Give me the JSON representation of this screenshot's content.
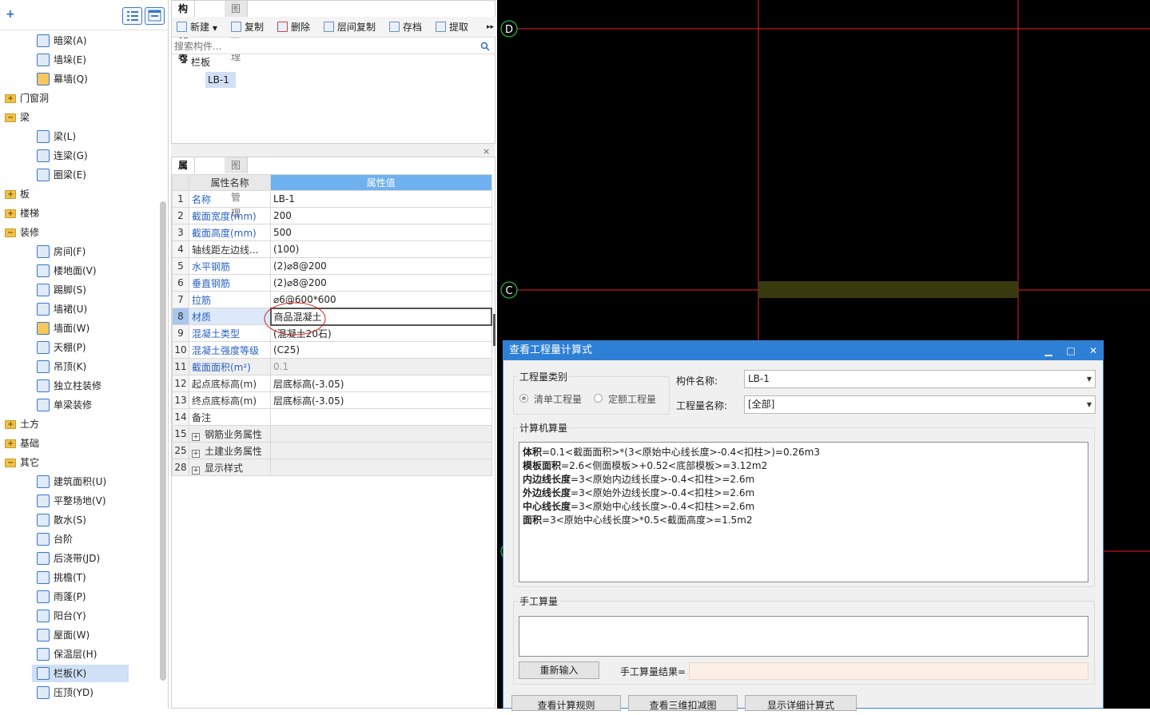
{
  "tree": {
    "toolbar": {
      "add_icon": "add-plus-icon",
      "list_icon": "list-view-icon",
      "window_icon": "window-view-icon"
    },
    "items": [
      {
        "label": "暗梁(A)",
        "level": 2,
        "icon": "hidden-beam-icon"
      },
      {
        "label": "墙垛(E)",
        "level": 2,
        "icon": "wall-pier-icon"
      },
      {
        "label": "幕墙(Q)",
        "level": 2,
        "icon": "curtain-wall-icon"
      },
      {
        "label": "门窗洞",
        "level": 1,
        "icon": "folder-icon",
        "sign": "+"
      },
      {
        "label": "梁",
        "level": 1,
        "icon": "folder-icon",
        "sign": "-"
      },
      {
        "label": "梁(L)",
        "level": 2,
        "icon": "beam-icon"
      },
      {
        "label": "连梁(G)",
        "level": 2,
        "icon": "coupling-beam-icon"
      },
      {
        "label": "圈梁(E)",
        "level": 2,
        "icon": "ring-beam-icon"
      },
      {
        "label": "板",
        "level": 1,
        "icon": "folder-icon",
        "sign": "+"
      },
      {
        "label": "楼梯",
        "level": 1,
        "icon": "folder-icon",
        "sign": "+"
      },
      {
        "label": "装修",
        "level": 1,
        "icon": "folder-icon",
        "sign": "-"
      },
      {
        "label": "房间(F)",
        "level": 2,
        "icon": "room-icon"
      },
      {
        "label": "楼地面(V)",
        "level": 2,
        "icon": "floor-icon"
      },
      {
        "label": "踢脚(S)",
        "level": 2,
        "icon": "skirting-icon"
      },
      {
        "label": "墙裙(U)",
        "level": 2,
        "icon": "dado-icon"
      },
      {
        "label": "墙面(W)",
        "level": 2,
        "icon": "wall-surface-icon"
      },
      {
        "label": "天棚(P)",
        "level": 2,
        "icon": "ceiling-icon"
      },
      {
        "label": "吊顶(K)",
        "level": 2,
        "icon": "suspended-ceiling-icon"
      },
      {
        "label": "独立柱装修",
        "level": 2,
        "icon": "column-finish-icon"
      },
      {
        "label": "单梁装修",
        "level": 2,
        "icon": "beam-finish-icon"
      },
      {
        "label": "土方",
        "level": 1,
        "icon": "folder-icon",
        "sign": "+"
      },
      {
        "label": "基础",
        "level": 1,
        "icon": "folder-icon",
        "sign": "+"
      },
      {
        "label": "其它",
        "level": 1,
        "icon": "folder-icon",
        "sign": "-"
      },
      {
        "label": "建筑面积(U)",
        "level": 2,
        "icon": "building-area-icon"
      },
      {
        "label": "平整场地(V)",
        "level": 2,
        "icon": "site-leveling-icon"
      },
      {
        "label": "散水(S)",
        "level": 2,
        "icon": "apron-icon"
      },
      {
        "label": "台阶",
        "level": 2,
        "icon": "steps-icon"
      },
      {
        "label": "后浇带(JD)",
        "level": 2,
        "icon": "post-pour-strip-icon"
      },
      {
        "label": "挑檐(T)",
        "level": 2,
        "icon": "eave-icon"
      },
      {
        "label": "雨蓬(P)",
        "level": 2,
        "icon": "canopy-icon"
      },
      {
        "label": "阳台(Y)",
        "level": 2,
        "icon": "balcony-icon"
      },
      {
        "label": "屋面(W)",
        "level": 2,
        "icon": "roof-icon"
      },
      {
        "label": "保温层(H)",
        "level": 2,
        "icon": "insulation-icon"
      },
      {
        "label": "栏板(K)",
        "level": 2,
        "icon": "parapet-icon",
        "selected": true
      },
      {
        "label": "压顶(YD)",
        "level": 2,
        "icon": "coping-icon"
      }
    ]
  },
  "component_panel": {
    "tabs": [
      "构件列表",
      "图纸管理"
    ],
    "toolbar": [
      {
        "label": "新建",
        "icon": "new-icon",
        "dropdown": true
      },
      {
        "label": "复制",
        "icon": "copy-icon"
      },
      {
        "label": "删除",
        "icon": "delete-icon"
      },
      {
        "label": "层间复制",
        "icon": "layer-copy-icon"
      },
      {
        "label": "存档",
        "icon": "archive-icon"
      },
      {
        "label": "提取",
        "icon": "extract-icon"
      }
    ],
    "search_placeholder": "搜索构件...",
    "tree_group": "栏板",
    "tree_item": "LB-1"
  },
  "property_panel": {
    "tabs": [
      "属性列表",
      "图层管理"
    ],
    "headers": {
      "name": "属性名称",
      "value": "属性值"
    },
    "rows": [
      {
        "n": "1",
        "name": "名称",
        "value": "LB-1",
        "blue": true
      },
      {
        "n": "2",
        "name": "截面宽度(mm)",
        "value": "200",
        "blue": true
      },
      {
        "n": "3",
        "name": "截面高度(mm)",
        "value": "500",
        "blue": true
      },
      {
        "n": "4",
        "name": "轴线距左边线...",
        "value": "(100)",
        "blue": false
      },
      {
        "n": "5",
        "name": "水平钢筋",
        "value": "(2)⌀8@200",
        "blue": true
      },
      {
        "n": "6",
        "name": "垂直钢筋",
        "value": "(2)⌀8@200",
        "blue": true
      },
      {
        "n": "7",
        "name": "拉筋",
        "value": "⌀6@600*600",
        "blue": true
      },
      {
        "n": "8",
        "name": "材质",
        "value": "商品混凝土",
        "blue": true,
        "current": true
      },
      {
        "n": "9",
        "name": "混凝土类型",
        "value": "(混凝土20石)",
        "blue": true
      },
      {
        "n": "10",
        "name": "混凝土强度等级",
        "value": "(C25)",
        "blue": true
      },
      {
        "n": "11",
        "name": "截面面积(m²)",
        "value": "0.1",
        "blue": true,
        "gray": true
      },
      {
        "n": "12",
        "name": "起点底标高(m)",
        "value": "层底标高(-3.05)",
        "blue": false
      },
      {
        "n": "13",
        "name": "终点底标高(m)",
        "value": "层底标高(-3.05)",
        "blue": false
      },
      {
        "n": "14",
        "name": "备注",
        "value": "",
        "blue": false
      },
      {
        "n": "15",
        "name": "钢筋业务属性",
        "value": "",
        "group": true
      },
      {
        "n": "25",
        "name": "土建业务属性",
        "value": "",
        "group": true
      },
      {
        "n": "28",
        "name": "显示样式",
        "value": "",
        "group": true
      }
    ]
  },
  "cad": {
    "axis_labels": [
      "D",
      "C"
    ],
    "line_color": "#e8202a",
    "highlight_color": "#3a3a10"
  },
  "dialog": {
    "title": "查看工程量计算式",
    "category_label": "工程量类别",
    "radio_list": "清单工程量",
    "radio_quota": "定额工程量",
    "component_name_label": "构件名称:",
    "component_name_value": "LB-1",
    "quantity_name_label": "工程量名称:",
    "quantity_name_value": "[全部]",
    "computer_calc_label": "计算机算量",
    "calc_lines": [
      {
        "key": "体积",
        "expr": "=0.1<截面面积>*(3<原始中心线长度>-0.4<扣柱>)=0.26m3"
      },
      {
        "key": "模板面积",
        "expr": "=2.6<侧面模板>+0.52<底部模板>=3.12m2"
      },
      {
        "key": "内边线长度",
        "expr": "=3<原始内边线长度>-0.4<扣柱>=2.6m"
      },
      {
        "key": "外边线长度",
        "expr": "=3<原始外边线长度>-0.4<扣柱>=2.6m"
      },
      {
        "key": "中心线长度",
        "expr": "=3<原始中心线长度>-0.4<扣柱>=2.6m"
      },
      {
        "key": "面积",
        "expr": "=3<原始中心线长度>*0.5<截面高度>=1.5m2"
      }
    ],
    "manual_label": "手工算量",
    "reinput_button": "重新输入",
    "manual_result_label": "手工算量结果=",
    "bottom_buttons": [
      "查看计算规则",
      "查看三维扣减图",
      "显示详细计算式"
    ]
  }
}
